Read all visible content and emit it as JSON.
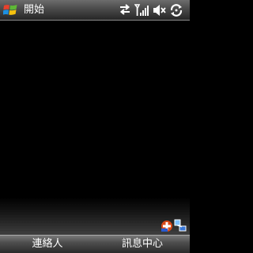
{
  "titlebar": {
    "start_label": "開始",
    "icons": [
      "windows-logo-icon",
      "connectivity-arrows-icon",
      "signal-strength-icon",
      "volume-muted-icon",
      "sync-icon"
    ]
  },
  "tray": {
    "icons": [
      "notification-icon",
      "device-connection-icon"
    ]
  },
  "softkeys": {
    "left_label": "連絡人",
    "right_label": "訊息中心"
  },
  "colors": {
    "background": "#000000",
    "logo_red": "#e8412c",
    "logo_green": "#5fb836",
    "logo_blue": "#1e90e0",
    "logo_yellow": "#f6c20e"
  }
}
